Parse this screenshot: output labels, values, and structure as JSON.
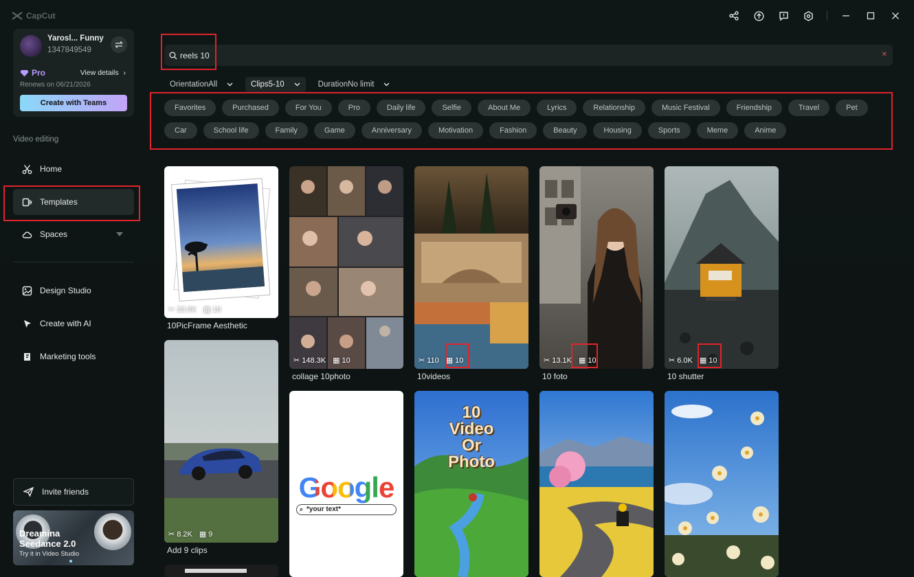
{
  "app": {
    "name": "CapCut"
  },
  "window_controls": [
    "share-icon",
    "upload-icon",
    "feedback-icon",
    "settings-icon",
    "minimize-icon",
    "maximize-icon",
    "close-icon"
  ],
  "profile": {
    "name": "Yarosl... Funny",
    "id": "1347849549",
    "plan": "Pro",
    "view_details": "View details",
    "renews": "Renews on 06/21/2026",
    "cta": "Create with Teams"
  },
  "sidebar": {
    "section_label": "Video editing",
    "items": [
      {
        "label": "Home",
        "icon": "scissors-icon"
      },
      {
        "label": "Templates",
        "icon": "template-icon",
        "active": true
      },
      {
        "label": "Spaces",
        "icon": "cloud-icon"
      }
    ],
    "tools": [
      {
        "label": "Design Studio",
        "icon": "design-icon"
      },
      {
        "label": "Create with AI",
        "icon": "ai-sparkle-icon"
      },
      {
        "label": "Marketing tools",
        "icon": "marketing-icon"
      }
    ],
    "invite": "Invite friends",
    "promo": {
      "title_line1": "Dreamina",
      "title_line2": "Seedance 2.0",
      "subtitle": "Try it in Video Studio"
    }
  },
  "search": {
    "value": "reels 10"
  },
  "filters": [
    {
      "label": "Orientation",
      "value": "All",
      "active": false
    },
    {
      "label": "Clips",
      "value": "5-10",
      "active": true
    },
    {
      "label": "Duration",
      "value": "No limit",
      "active": false
    }
  ],
  "chips": [
    "Favorites",
    "Purchased",
    "For You",
    "Pro",
    "Daily life",
    "Selfie",
    "About Me",
    "Lyrics",
    "Relationship",
    "Music Festival",
    "Friendship",
    "Travel",
    "Pet",
    "Car",
    "School life",
    "Family",
    "Game",
    "Anniversary",
    "Motivation",
    "Fashion",
    "Beauty",
    "Housing",
    "Sports",
    "Meme",
    "Anime"
  ],
  "templates": [
    {
      "title": "10PicFrame Aesthetic",
      "uses": "33.9K",
      "clips": "10"
    },
    {
      "title": "collage 10photo",
      "uses": "148.3K",
      "clips": "10"
    },
    {
      "title": "10videos",
      "uses": "110",
      "clips": "10"
    },
    {
      "title": "10 foto",
      "uses": "13.1K",
      "clips": "10"
    },
    {
      "title": "10 shutter",
      "uses": "6.0K",
      "clips": "10"
    },
    {
      "title": "Add 9 clips",
      "uses": "8.2K",
      "clips": "9"
    }
  ],
  "thumb_text": {
    "google_logo": "Google",
    "google_search": "*your text*",
    "poster_line1": "10",
    "poster_line2": "Video",
    "poster_line3": "Or",
    "poster_line4": "Photo"
  },
  "colors": {
    "highlight": "#e0242b",
    "pro": "#b79cff",
    "accent_gradient_start": "#8ad8f8",
    "accent_gradient_end": "#c2a4f7"
  }
}
